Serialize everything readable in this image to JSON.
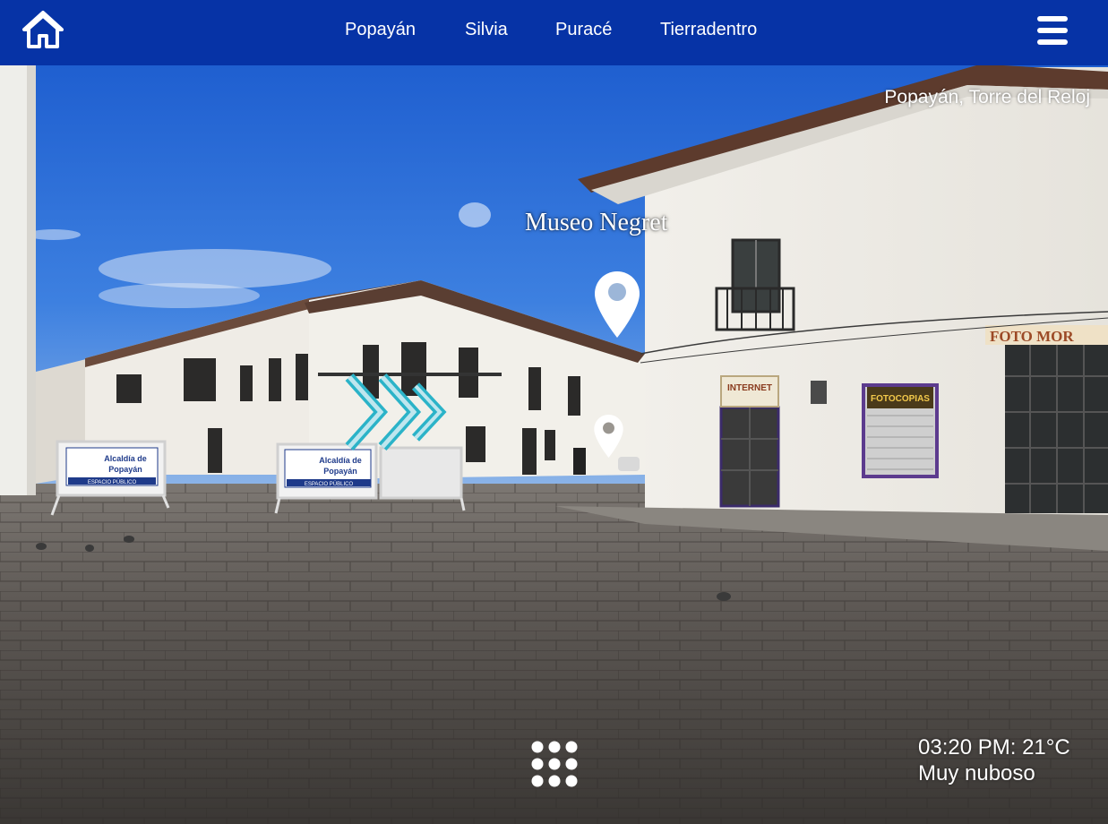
{
  "header": {
    "home_icon": "home-icon",
    "nav_links": [
      {
        "label": "Popayán"
      },
      {
        "label": "Silvia"
      },
      {
        "label": "Puracé"
      },
      {
        "label": "Tierradentro"
      }
    ],
    "menu_icon": "hamburger-menu-icon",
    "background_color": "#0633a6"
  },
  "scene": {
    "location_title": "Popayán, Torre del Reloj",
    "hotspot": {
      "label": "Museo Negret",
      "icon": "map-pin-icon"
    },
    "secondary_pin_icon": "map-pin-icon",
    "navigation_arrow_icon": "triple-chevron-right-icon",
    "signs": [
      {
        "line1": "Alcaldía de",
        "line2": "Popayán",
        "footer": "ESPACIO PÚBLICO"
      },
      {
        "line1": "Alcaldía de",
        "line2": "Popayán",
        "footer": "ESPACIO PÚBLICO"
      }
    ],
    "shop_signs": {
      "internet": "INTERNET",
      "fotocopias": "FOTOCOPIAS",
      "foto": "FOTO MOR"
    }
  },
  "footer": {
    "grid_icon": "grid-menu-icon",
    "weather": {
      "time_temp": "03:20 PM: 21°C",
      "condition": "Muy nuboso"
    }
  }
}
